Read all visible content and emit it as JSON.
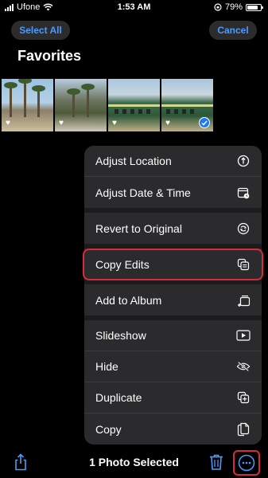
{
  "status_bar": {
    "carrier": "Ufone",
    "time": "1:53 AM",
    "battery": "79%",
    "battery_level": 0.79,
    "icons": [
      "signal-icon",
      "wifi-icon",
      "orientation-lock-icon",
      "battery-icon"
    ]
  },
  "header": {
    "select_all": "Select All",
    "cancel": "Cancel",
    "title": "Favorites"
  },
  "thumbnails": [
    {
      "favorite": true,
      "selected": false
    },
    {
      "favorite": true,
      "selected": false
    },
    {
      "favorite": true,
      "selected": false
    },
    {
      "favorite": true,
      "selected": true
    }
  ],
  "menu": {
    "items": [
      {
        "label": "Adjust Location",
        "icon": "location-info-icon"
      },
      {
        "label": "Adjust Date & Time",
        "icon": "calendar-clock-icon"
      },
      {
        "label": "Revert to Original",
        "icon": "revert-icon"
      },
      {
        "label": "Copy Edits",
        "icon": "copy-edits-icon",
        "highlighted": true
      },
      {
        "label": "Add to Album",
        "icon": "add-to-album-icon"
      },
      {
        "label": "Slideshow",
        "icon": "play-icon"
      },
      {
        "label": "Hide",
        "icon": "eye-slash-icon"
      },
      {
        "label": "Duplicate",
        "icon": "duplicate-icon"
      },
      {
        "label": "Copy",
        "icon": "copy-icon"
      }
    ]
  },
  "bottom_bar": {
    "selected_text": "1 Photo Selected",
    "icons": [
      "share-icon",
      "trash-icon",
      "more-icon"
    ]
  },
  "colors": {
    "accent": "#4a9bff",
    "highlight_border": "#d82b3a",
    "menu_bg": "#2b2b2d",
    "check_blue": "#1a7cf5"
  }
}
